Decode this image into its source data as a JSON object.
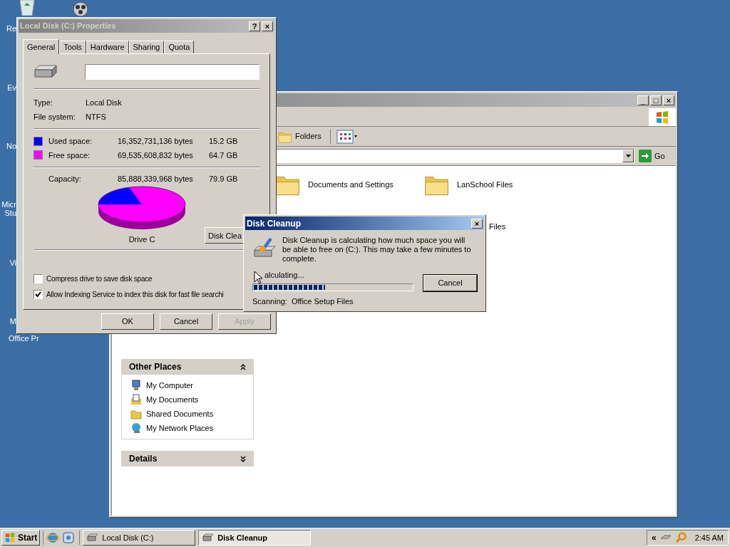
{
  "desktop_icons": [
    {
      "lines": [
        "Re"
      ]
    },
    {
      "lines": [
        "Ev"
      ]
    },
    {
      "lines": [
        "No"
      ]
    },
    {
      "lines": [
        "Micr",
        "Stu"
      ]
    },
    {
      "lines": [
        "Vi"
      ]
    },
    {
      "lines": [
        "M",
        "Office Pr"
      ]
    }
  ],
  "explorer": {
    "toolbar": {
      "folders": "Folders"
    },
    "address_bar": {
      "go": "Go"
    },
    "folders": [
      {
        "label": "Documents and Settings"
      },
      {
        "label": "LanSchool Files"
      }
    ],
    "partial_item": "Files",
    "panels": [
      {
        "title": "Other Places",
        "expanded": true,
        "links": [
          {
            "label": "My Computer"
          },
          {
            "label": "My Documents"
          },
          {
            "label": "Shared Documents"
          },
          {
            "label": "My Network Places"
          }
        ]
      },
      {
        "title": "Details",
        "expanded": false
      }
    ],
    "window_buttons": [
      "_",
      "□",
      "×"
    ]
  },
  "properties": {
    "title": "Local Disk (C:) Properties",
    "help": "?",
    "close": "×",
    "tabs": [
      {
        "label": "General",
        "selected": true
      },
      {
        "label": "Tools",
        "selected": false
      },
      {
        "label": "Hardware",
        "selected": false
      },
      {
        "label": "Sharing",
        "selected": false
      },
      {
        "label": "Quota",
        "selected": false
      }
    ],
    "type_label": "Type:",
    "type_value": "Local Disk",
    "fs_label": "File system:",
    "fs_value": "NTFS",
    "space": [
      {
        "label": "Used space:",
        "bytes": "16,352,731,136 bytes",
        "size": "15.2 GB",
        "color": "#0000ff"
      },
      {
        "label": "Free space:",
        "bytes": "69,535,608,832 bytes",
        "size": "64.7 GB",
        "color": "#ff00ff"
      }
    ],
    "capacity": {
      "label": "Capacity:",
      "bytes": "85,888,339,968 bytes",
      "size": "79.9 GB"
    },
    "drive_label": "Drive C",
    "cleanup_button": "Disk Clea",
    "options": [
      {
        "label": "Compress drive to save disk space",
        "checked": false
      },
      {
        "label": "Allow Indexing Service to index this disk for fast file searchi",
        "checked": true
      }
    ],
    "buttons": [
      {
        "label": "OK",
        "disabled": false
      },
      {
        "label": "Cancel",
        "disabled": false
      },
      {
        "label": "Apply",
        "disabled": true
      }
    ]
  },
  "cleanup": {
    "title": "Disk Cleanup",
    "close": "×",
    "message": "Disk Cleanup is calculating how much space you will be able to free on  (C:). This may take a few minutes to complete.",
    "status": "alculating...",
    "progress": {
      "level": 0.45
    },
    "cancel": "Cancel",
    "scanning_label": "Scanning:",
    "scanning_value": "Office Setup Files"
  },
  "taskbar": {
    "start": "Start",
    "tasks": [
      {
        "label": "Local Disk (C:)",
        "selected": false
      },
      {
        "label": "Disk Cleanup",
        "selected": true
      }
    ],
    "chevron": "«",
    "time": "2:45 AM"
  }
}
